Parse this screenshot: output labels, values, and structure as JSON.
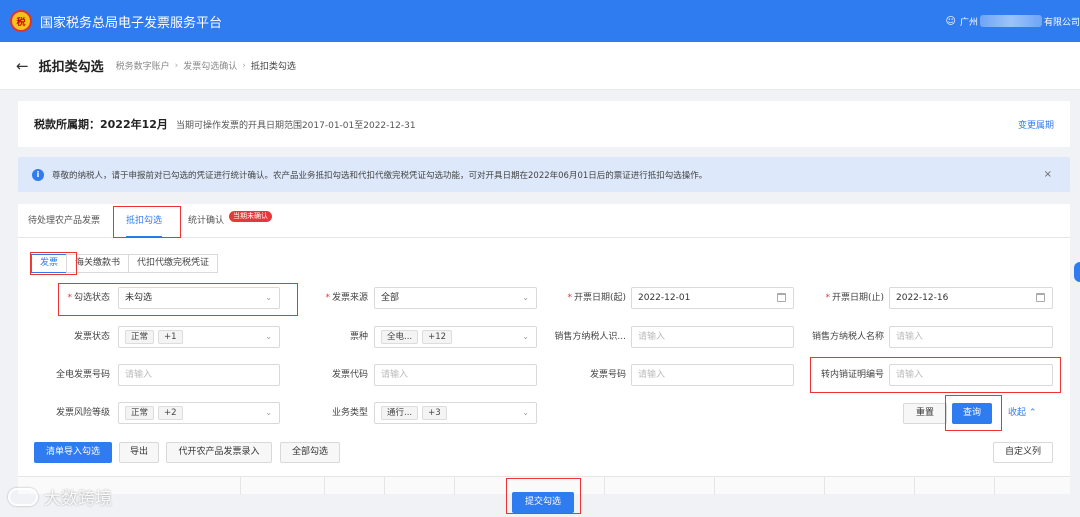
{
  "header": {
    "logo_text": "税",
    "title": "国家税务总局电子发票服务平台",
    "user_prefix": "广州",
    "user_suffix": "有限公司"
  },
  "breadcrumb": {
    "page_title": "抵扣类勾选",
    "items": [
      "税务数字账户",
      "发票勾选确认",
      "抵扣类勾选"
    ]
  },
  "period": {
    "label": "税款所属期：2022年12月",
    "note": "当期可操作发票的开具日期范围2017-01-01至2022-12-31",
    "change_link": "变更属期"
  },
  "notice": {
    "text": "尊敬的纳税人，请于申报前对已勾选的凭证进行统计确认。农产品业务抵扣勾选和代扣代缴完税凭证勾选功能，可对开具日期在2022年06月01日后的票证进行抵扣勾选操作。"
  },
  "tabs": {
    "pending": "待处理农产品发票",
    "deduct": "抵扣勾选",
    "stats": "统计确认",
    "stats_badge": "当期未确认"
  },
  "subtabs": {
    "invoice": "发票",
    "customs": "海关缴款书",
    "withhold": "代扣代缴完税凭证"
  },
  "form": {
    "select_status_label": "勾选状态",
    "select_status_value": "未勾选",
    "source_label": "发票来源",
    "source_value": "全部",
    "date_start_label": "开票日期(起)",
    "date_start_value": "2022-12-01",
    "date_end_label": "开票日期(止)",
    "date_end_value": "2022-12-16",
    "invoice_status_label": "发票状态",
    "invoice_status_tag": "正常",
    "invoice_status_more": "+1",
    "type_label": "票种",
    "type_tag": "全电...",
    "type_more": "+12",
    "seller_id_label": "销售方纳税人识...",
    "seller_id_placeholder": "请输入",
    "seller_name_label": "销售方纳税人名称",
    "seller_name_placeholder": "请输入",
    "full_number_label": "全电发票号码",
    "full_number_placeholder": "请输入",
    "code_label": "发票代码",
    "code_placeholder": "请输入",
    "number_label": "发票号码",
    "number_placeholder": "请输入",
    "transfer_label": "转内销证明编号",
    "transfer_placeholder": "请输入",
    "risk_label": "发票风险等级",
    "risk_tag": "正常",
    "risk_more": "+2",
    "biz_label": "业务类型",
    "biz_tag": "通行...",
    "biz_more": "+3"
  },
  "actions": {
    "reset": "重置",
    "query": "查询",
    "collapse": "收起"
  },
  "toolbar": {
    "import": "清单导入勾选",
    "export": "导出",
    "agri_entry": "代开农产品发票录入",
    "select_all": "全部勾选",
    "custom_columns": "自定义列"
  },
  "submit": "提交勾选",
  "watermark": "大数跨境"
}
